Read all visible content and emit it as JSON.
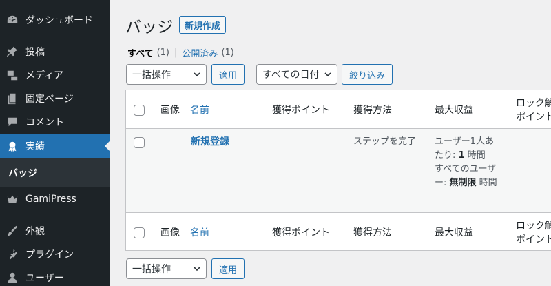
{
  "sidebar": {
    "items": [
      {
        "label": "ダッシュボード",
        "icon": "dashboard-icon"
      },
      {
        "label": "投稿",
        "icon": "pin-icon"
      },
      {
        "label": "メディア",
        "icon": "media-icon"
      },
      {
        "label": "固定ページ",
        "icon": "page-icon"
      },
      {
        "label": "コメント",
        "icon": "comment-icon"
      },
      {
        "label": "実績",
        "icon": "award-icon"
      },
      {
        "label": "GamiPress",
        "icon": "crown-icon"
      },
      {
        "label": "外観",
        "icon": "brush-icon"
      },
      {
        "label": "プラグイン",
        "icon": "plugin-icon"
      },
      {
        "label": "ユーザー",
        "icon": "user-icon"
      }
    ],
    "submenu": {
      "label": "バッジ"
    }
  },
  "header": {
    "title": "バッジ",
    "new_button": "新規作成"
  },
  "filters": {
    "all_label": "すべて",
    "all_count": "(1)",
    "separator": "|",
    "published_label": "公開済み",
    "published_count": "(1)"
  },
  "actions": {
    "bulk_select": "一括操作",
    "apply": "適用",
    "date_select": "すべての日付",
    "filter": "絞り込み"
  },
  "table": {
    "columns": [
      "画像",
      "名前",
      "獲得ポイント",
      "獲得方法",
      "最大収益",
      "ロック解",
      "ポイント"
    ],
    "row": {
      "name": "新規登録",
      "method": "ステップを完了",
      "max_line1": "ユーザー1人あ",
      "max_line2_pre": "たり: ",
      "max_line2_bold": "1",
      "max_line2_post": " 時間",
      "max_line3": "すべてのユーザ",
      "max_line4_pre": "ー: ",
      "max_line4_bold": "無制限",
      "max_line4_post": " 時間"
    }
  },
  "bottom_actions": {
    "bulk_select": "一括操作",
    "apply": "適用"
  },
  "colors": {
    "sidebar_bg": "#1d2327",
    "accent": "#2271b1"
  }
}
